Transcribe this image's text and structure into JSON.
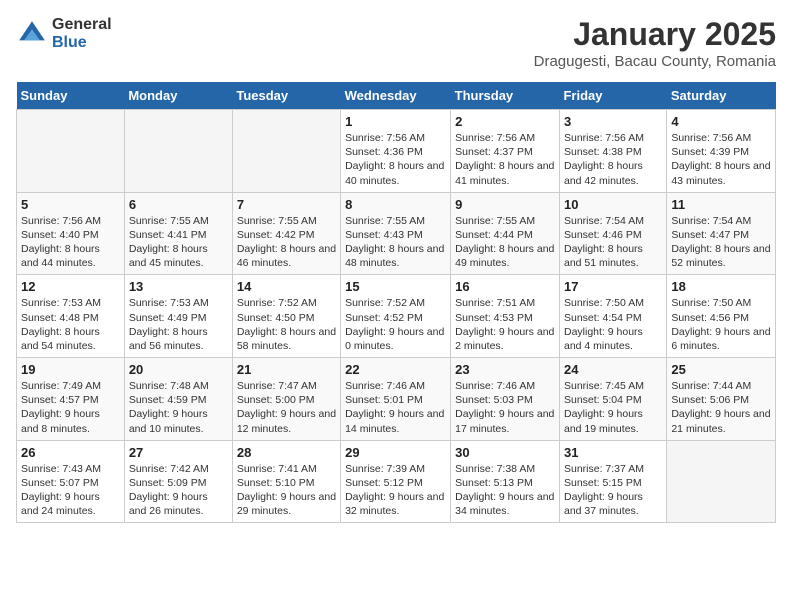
{
  "logo": {
    "general": "General",
    "blue": "Blue"
  },
  "title": "January 2025",
  "subtitle": "Dragugesti, Bacau County, Romania",
  "days_of_week": [
    "Sunday",
    "Monday",
    "Tuesday",
    "Wednesday",
    "Thursday",
    "Friday",
    "Saturday"
  ],
  "weeks": [
    [
      {
        "day": "",
        "sunrise": "",
        "sunset": "",
        "daylight": ""
      },
      {
        "day": "",
        "sunrise": "",
        "sunset": "",
        "daylight": ""
      },
      {
        "day": "",
        "sunrise": "",
        "sunset": "",
        "daylight": ""
      },
      {
        "day": "1",
        "sunrise": "Sunrise: 7:56 AM",
        "sunset": "Sunset: 4:36 PM",
        "daylight": "Daylight: 8 hours and 40 minutes."
      },
      {
        "day": "2",
        "sunrise": "Sunrise: 7:56 AM",
        "sunset": "Sunset: 4:37 PM",
        "daylight": "Daylight: 8 hours and 41 minutes."
      },
      {
        "day": "3",
        "sunrise": "Sunrise: 7:56 AM",
        "sunset": "Sunset: 4:38 PM",
        "daylight": "Daylight: 8 hours and 42 minutes."
      },
      {
        "day": "4",
        "sunrise": "Sunrise: 7:56 AM",
        "sunset": "Sunset: 4:39 PM",
        "daylight": "Daylight: 8 hours and 43 minutes."
      }
    ],
    [
      {
        "day": "5",
        "sunrise": "Sunrise: 7:56 AM",
        "sunset": "Sunset: 4:40 PM",
        "daylight": "Daylight: 8 hours and 44 minutes."
      },
      {
        "day": "6",
        "sunrise": "Sunrise: 7:55 AM",
        "sunset": "Sunset: 4:41 PM",
        "daylight": "Daylight: 8 hours and 45 minutes."
      },
      {
        "day": "7",
        "sunrise": "Sunrise: 7:55 AM",
        "sunset": "Sunset: 4:42 PM",
        "daylight": "Daylight: 8 hours and 46 minutes."
      },
      {
        "day": "8",
        "sunrise": "Sunrise: 7:55 AM",
        "sunset": "Sunset: 4:43 PM",
        "daylight": "Daylight: 8 hours and 48 minutes."
      },
      {
        "day": "9",
        "sunrise": "Sunrise: 7:55 AM",
        "sunset": "Sunset: 4:44 PM",
        "daylight": "Daylight: 8 hours and 49 minutes."
      },
      {
        "day": "10",
        "sunrise": "Sunrise: 7:54 AM",
        "sunset": "Sunset: 4:46 PM",
        "daylight": "Daylight: 8 hours and 51 minutes."
      },
      {
        "day": "11",
        "sunrise": "Sunrise: 7:54 AM",
        "sunset": "Sunset: 4:47 PM",
        "daylight": "Daylight: 8 hours and 52 minutes."
      }
    ],
    [
      {
        "day": "12",
        "sunrise": "Sunrise: 7:53 AM",
        "sunset": "Sunset: 4:48 PM",
        "daylight": "Daylight: 8 hours and 54 minutes."
      },
      {
        "day": "13",
        "sunrise": "Sunrise: 7:53 AM",
        "sunset": "Sunset: 4:49 PM",
        "daylight": "Daylight: 8 hours and 56 minutes."
      },
      {
        "day": "14",
        "sunrise": "Sunrise: 7:52 AM",
        "sunset": "Sunset: 4:50 PM",
        "daylight": "Daylight: 8 hours and 58 minutes."
      },
      {
        "day": "15",
        "sunrise": "Sunrise: 7:52 AM",
        "sunset": "Sunset: 4:52 PM",
        "daylight": "Daylight: 9 hours and 0 minutes."
      },
      {
        "day": "16",
        "sunrise": "Sunrise: 7:51 AM",
        "sunset": "Sunset: 4:53 PM",
        "daylight": "Daylight: 9 hours and 2 minutes."
      },
      {
        "day": "17",
        "sunrise": "Sunrise: 7:50 AM",
        "sunset": "Sunset: 4:54 PM",
        "daylight": "Daylight: 9 hours and 4 minutes."
      },
      {
        "day": "18",
        "sunrise": "Sunrise: 7:50 AM",
        "sunset": "Sunset: 4:56 PM",
        "daylight": "Daylight: 9 hours and 6 minutes."
      }
    ],
    [
      {
        "day": "19",
        "sunrise": "Sunrise: 7:49 AM",
        "sunset": "Sunset: 4:57 PM",
        "daylight": "Daylight: 9 hours and 8 minutes."
      },
      {
        "day": "20",
        "sunrise": "Sunrise: 7:48 AM",
        "sunset": "Sunset: 4:59 PM",
        "daylight": "Daylight: 9 hours and 10 minutes."
      },
      {
        "day": "21",
        "sunrise": "Sunrise: 7:47 AM",
        "sunset": "Sunset: 5:00 PM",
        "daylight": "Daylight: 9 hours and 12 minutes."
      },
      {
        "day": "22",
        "sunrise": "Sunrise: 7:46 AM",
        "sunset": "Sunset: 5:01 PM",
        "daylight": "Daylight: 9 hours and 14 minutes."
      },
      {
        "day": "23",
        "sunrise": "Sunrise: 7:46 AM",
        "sunset": "Sunset: 5:03 PM",
        "daylight": "Daylight: 9 hours and 17 minutes."
      },
      {
        "day": "24",
        "sunrise": "Sunrise: 7:45 AM",
        "sunset": "Sunset: 5:04 PM",
        "daylight": "Daylight: 9 hours and 19 minutes."
      },
      {
        "day": "25",
        "sunrise": "Sunrise: 7:44 AM",
        "sunset": "Sunset: 5:06 PM",
        "daylight": "Daylight: 9 hours and 21 minutes."
      }
    ],
    [
      {
        "day": "26",
        "sunrise": "Sunrise: 7:43 AM",
        "sunset": "Sunset: 5:07 PM",
        "daylight": "Daylight: 9 hours and 24 minutes."
      },
      {
        "day": "27",
        "sunrise": "Sunrise: 7:42 AM",
        "sunset": "Sunset: 5:09 PM",
        "daylight": "Daylight: 9 hours and 26 minutes."
      },
      {
        "day": "28",
        "sunrise": "Sunrise: 7:41 AM",
        "sunset": "Sunset: 5:10 PM",
        "daylight": "Daylight: 9 hours and 29 minutes."
      },
      {
        "day": "29",
        "sunrise": "Sunrise: 7:39 AM",
        "sunset": "Sunset: 5:12 PM",
        "daylight": "Daylight: 9 hours and 32 minutes."
      },
      {
        "day": "30",
        "sunrise": "Sunrise: 7:38 AM",
        "sunset": "Sunset: 5:13 PM",
        "daylight": "Daylight: 9 hours and 34 minutes."
      },
      {
        "day": "31",
        "sunrise": "Sunrise: 7:37 AM",
        "sunset": "Sunset: 5:15 PM",
        "daylight": "Daylight: 9 hours and 37 minutes."
      },
      {
        "day": "",
        "sunrise": "",
        "sunset": "",
        "daylight": ""
      }
    ]
  ]
}
